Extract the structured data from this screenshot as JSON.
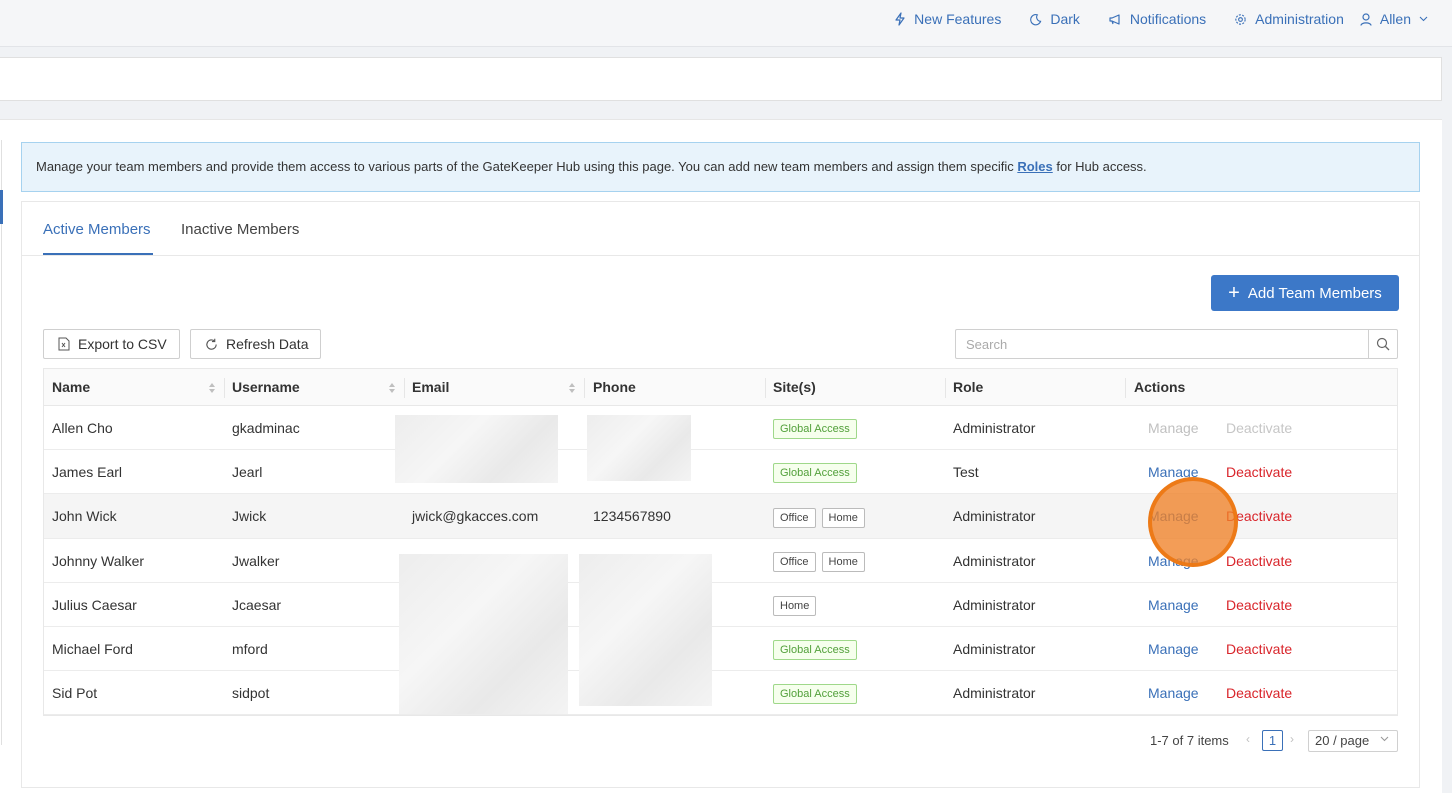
{
  "topnav": {
    "new_features": "New Features",
    "dark": "Dark",
    "notifications": "Notifications",
    "administration": "Administration",
    "user": "Allen"
  },
  "info": {
    "text_before": "Manage your team members and provide them access to various parts of the GateKeeper Hub using this page. You can add new team members and assign them specific ",
    "roles_link": "Roles",
    "text_after": " for Hub access."
  },
  "tabs": {
    "active": "Active Members",
    "inactive": "Inactive Members"
  },
  "toolbar": {
    "add_label": "Add Team Members",
    "export_label": "Export to CSV",
    "refresh_label": "Refresh Data",
    "search_placeholder": "Search"
  },
  "table": {
    "headers": {
      "name": "Name",
      "username": "Username",
      "email": "Email",
      "phone": "Phone",
      "sites": "Site(s)",
      "role": "Role",
      "actions": "Actions"
    },
    "manage_label": "Manage",
    "deactivate_label": "Deactivate",
    "rows": [
      {
        "name": "Allen Cho",
        "username": "gkadminac",
        "email": "",
        "phone": "",
        "site1": "Global Access",
        "site2": "",
        "role": "Administrator"
      },
      {
        "name": "James Earl",
        "username": "Jearl",
        "email": "",
        "phone": "",
        "site1": "Global Access",
        "site2": "",
        "role": "Test"
      },
      {
        "name": "John Wick",
        "username": "Jwick",
        "email": "jwick@gkacces.com",
        "phone": "1234567890",
        "site1": "Office",
        "site2": "Home",
        "role": "Administrator"
      },
      {
        "name": "Johnny Walker",
        "username": "Jwalker",
        "email": "",
        "phone": "",
        "site1": "Office",
        "site2": "Home",
        "role": "Administrator"
      },
      {
        "name": "Julius Caesar",
        "username": "Jcaesar",
        "email": "",
        "phone": "",
        "site1": "Home",
        "site2": "",
        "role": "Administrator"
      },
      {
        "name": "Michael Ford",
        "username": "mford",
        "email": "",
        "phone": "",
        "site1": "Global Access",
        "site2": "",
        "role": "Administrator"
      },
      {
        "name": "Sid Pot",
        "username": "sidpot",
        "email": "",
        "phone": "",
        "site1": "Global Access",
        "site2": "",
        "role": "Administrator"
      }
    ]
  },
  "pagination": {
    "total": "1-7 of 7 items",
    "current_page": "1",
    "page_size": "20 / page"
  },
  "colors": {
    "accent": "#3a70b8",
    "primary_button": "#3c78c8",
    "danger": "#d9252b",
    "tag_green": "#52a03a",
    "click_indicator": "#f08228"
  }
}
